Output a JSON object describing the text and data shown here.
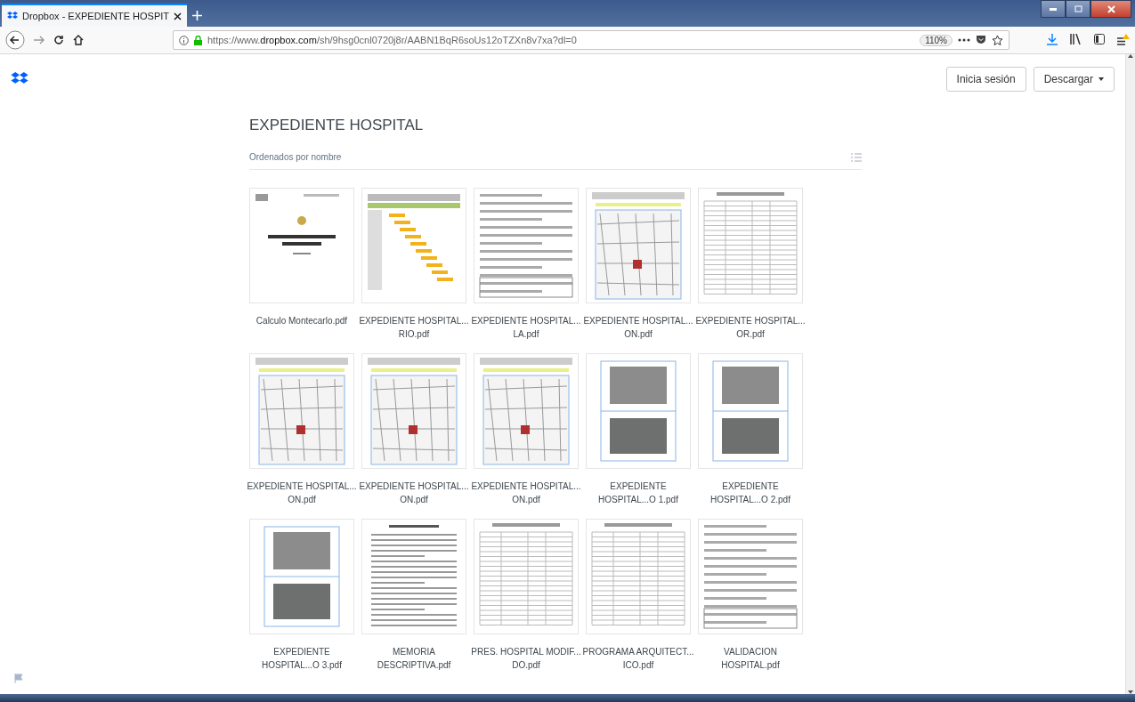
{
  "browser": {
    "tab": {
      "title": "Dropbox - EXPEDIENTE HOSPIT",
      "selected": true
    },
    "url_prefix": "https://www.",
    "url_domain": "dropbox.com",
    "url_path": "/sh/9hsg0cnl0720j8r/AABN1BqR6soUs12oTZXn8v7xa?dl=0",
    "zoom": "110%"
  },
  "header": {
    "buttons": [
      "Inicia sesión",
      "Descargar"
    ]
  },
  "folder": {
    "title": "EXPEDIENTE HOSPITAL",
    "sort_label": "Ordenados por nombre"
  },
  "files": [
    {
      "name": [
        "Calculo Montecarlo.pdf"
      ],
      "kind": "cover"
    },
    {
      "name": [
        "EXPEDIENTE HOSPITAL...",
        "RIO.pdf"
      ],
      "kind": "schedule"
    },
    {
      "name": [
        "EXPEDIENTE HOSPITAL...",
        "LA.pdf"
      ],
      "kind": "form"
    },
    {
      "name": [
        "EXPEDIENTE HOSPITAL...",
        "ON.pdf"
      ],
      "kind": "map"
    },
    {
      "name": [
        "EXPEDIENTE HOSPITAL...",
        "OR.pdf"
      ],
      "kind": "table"
    },
    {
      "name": [
        "EXPEDIENTE HOSPITAL...",
        "ON.pdf"
      ],
      "kind": "map"
    },
    {
      "name": [
        "EXPEDIENTE HOSPITAL...",
        "ON.pdf"
      ],
      "kind": "map"
    },
    {
      "name": [
        "EXPEDIENTE HOSPITAL...",
        "ON.pdf"
      ],
      "kind": "map"
    },
    {
      "name": [
        "EXPEDIENTE",
        "HOSPITAL...O 1.pdf"
      ],
      "kind": "photos"
    },
    {
      "name": [
        "EXPEDIENTE",
        "HOSPITAL...O 2.pdf"
      ],
      "kind": "photos"
    },
    {
      "name": [
        "EXPEDIENTE",
        "HOSPITAL...O 3.pdf"
      ],
      "kind": "photos"
    },
    {
      "name": [
        "MEMORIA",
        "DESCRIPTIVA.pdf"
      ],
      "kind": "text"
    },
    {
      "name": [
        "PRES. HOSPITAL MODIF...",
        "DO.pdf"
      ],
      "kind": "table"
    },
    {
      "name": [
        "PROGRAMA ARQUITECT...",
        "ICO.pdf"
      ],
      "kind": "table"
    },
    {
      "name": [
        "VALIDACION",
        "HOSPITAL.pdf"
      ],
      "kind": "form"
    }
  ]
}
